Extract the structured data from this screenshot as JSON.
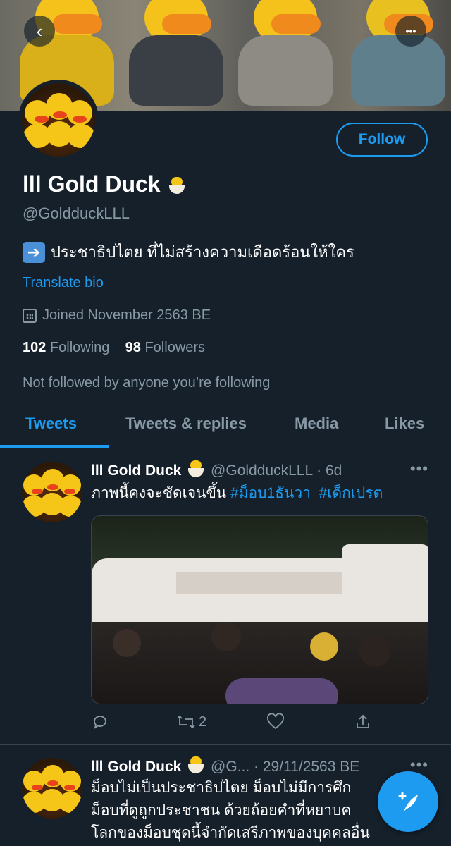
{
  "profile": {
    "name": "lll Gold Duck",
    "handle": "@GoldduckLLL",
    "follow_label": "Follow",
    "bio_icon": "➡️",
    "bio": "ประชาธิปไตย ที่ไม่สร้างความเดือดร้อนให้ใคร",
    "translate_label": "Translate bio",
    "joined": "Joined November 2563 BE",
    "following_count": "102",
    "following_label": "Following",
    "followers_count": "98",
    "followers_label": "Followers",
    "not_followed": "Not followed by anyone you’re following"
  },
  "nav": {
    "back_icon": "‹",
    "more_icon": "•••"
  },
  "tabs": [
    {
      "label": "Tweets"
    },
    {
      "label": "Tweets & replies"
    },
    {
      "label": "Media"
    },
    {
      "label": "Likes"
    }
  ],
  "tweets": [
    {
      "name": "lll Gold Duck",
      "handle_time": "@GoldduckLLL · 6d",
      "text": "ภาพนี้คงจะชัดเจนขึ้น",
      "hashtags": [
        "#ม็อบ1ธันวา",
        "#เด็กเปรต"
      ],
      "retweets": "2"
    },
    {
      "name": "lll Gold Duck",
      "handle_time": "@G... · 29/11/2563 BE",
      "lines": [
        "ม็อบไม่เป็นประชาธิปไตย ม็อบไม่มีการศึก",
        "ม็อบที่ดูถูกประชาชน ด้วยถ้อยคำที่หยาบค",
        "โลกของม็อบชุดนี้จำกัดเสรีภาพของบุคคลอื่น"
      ]
    }
  ],
  "colors": {
    "background": "#15202b",
    "accent": "#1d9bf0",
    "secondary_text": "#8899a6",
    "divider": "#38444d"
  }
}
